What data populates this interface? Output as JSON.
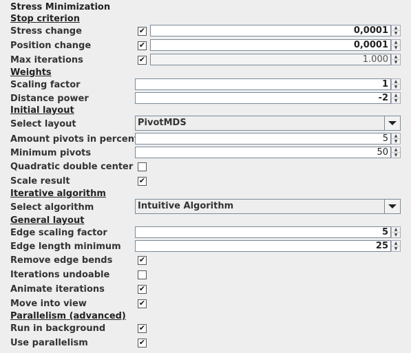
{
  "title": "Stress Minimization",
  "sections": {
    "stop": "Stop criterion",
    "weights": "Weights",
    "initial": "Initial layout",
    "iterative": "Iterative algorithm",
    "general": "General layout",
    "parallel": "Parallelism (advanced)"
  },
  "fields": {
    "stress_change": {
      "label": "Stress change",
      "enabled": true,
      "value": "0,0001"
    },
    "position_change": {
      "label": "Position change",
      "enabled": true,
      "value": "0,0001"
    },
    "max_iterations": {
      "label": "Max iterations",
      "enabled": true,
      "value": "1.000"
    },
    "scaling_factor": {
      "label": "Scaling factor",
      "value": "1"
    },
    "distance_power": {
      "label": "Distance power",
      "value": "-2"
    },
    "select_layout": {
      "label": "Select layout",
      "value": "PivotMDS"
    },
    "amount_pivots": {
      "label": "Amount pivots in percent",
      "value": "5"
    },
    "minimum_pivots": {
      "label": "Minimum pivots",
      "value": "50"
    },
    "quadratic_double_center": {
      "label": "Quadratic double center",
      "checked": false
    },
    "scale_result": {
      "label": "Scale result",
      "checked": true
    },
    "select_algorithm": {
      "label": "Select algorithm",
      "value": "Intuitive Algorithm"
    },
    "edge_scaling_factor": {
      "label": "Edge scaling factor",
      "value": "5"
    },
    "edge_length_minimum": {
      "label": "Edge length minimum",
      "value": "25"
    },
    "remove_edge_bends": {
      "label": "Remove edge bends",
      "checked": true
    },
    "iterations_undoable": {
      "label": "Iterations undoable",
      "checked": false
    },
    "animate_iterations": {
      "label": "Animate iterations",
      "checked": true
    },
    "move_into_view": {
      "label": "Move into view",
      "checked": true
    },
    "run_in_background": {
      "label": "Run in background",
      "checked": true
    },
    "use_parallelism": {
      "label": "Use parallelism",
      "checked": true
    }
  },
  "icons": {
    "check": "✔",
    "spin_up": "▲",
    "spin_down": "▼"
  }
}
